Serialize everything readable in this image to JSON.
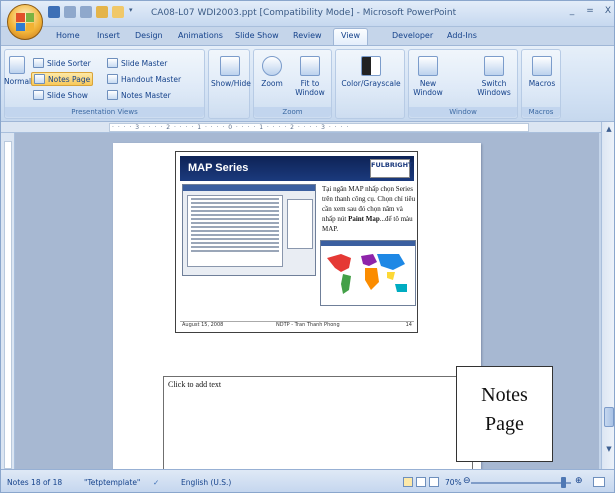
{
  "window": {
    "title": "CA08-L07 WDI2003.ppt [Compatibility Mode] - Microsoft PowerPoint",
    "controls": [
      "_",
      "=",
      "X"
    ]
  },
  "tabs": [
    {
      "label": "Home"
    },
    {
      "label": "Insert"
    },
    {
      "label": "Design"
    },
    {
      "label": "Animations"
    },
    {
      "label": "Slide Show"
    },
    {
      "label": "Review"
    },
    {
      "label": "View",
      "active": true
    },
    {
      "label": "Developer"
    },
    {
      "label": "Add-Ins"
    }
  ],
  "ribbon": {
    "presentation_views": {
      "normal": "Normal",
      "slide_sorter": "Slide Sorter",
      "notes_page": "Notes Page",
      "slide_show": "Slide Show",
      "slide_master": "Slide Master",
      "handout_master": "Handout Master",
      "notes_master": "Notes Master",
      "group_label": "Presentation Views"
    },
    "show_hide": "Show/Hide",
    "zoom": {
      "zoom": "Zoom",
      "fit_to_window": "Fit to Window",
      "group_label": "Zoom"
    },
    "color_grayscale": "Color/Grayscale",
    "window": {
      "new_window": "New Window",
      "switch_windows": "Switch Windows",
      "group_label": "Window"
    },
    "macros": {
      "macros": "Macros",
      "group_label": "Macros"
    }
  },
  "ruler": {
    "h_text": "· · · · 3 · · · · 2 · · · · 1 · · · · 0 · · · · 1 · · · · 2 · · · · 3 · · · ·"
  },
  "slide": {
    "title": "MAP Series",
    "logo": "FULBRIGHT",
    "note_line1": "Tại ngăn MAP nhấp chọn Series trên thanh công cụ. Chọn chỉ tiêu cần xem sau đó chọn năm và nhấp nút ",
    "note_bold": "Paint Map",
    "note_line2": "...để tô màu MAP.",
    "footer_left": "August 15, 2008",
    "footer_center": "NDTP - Tran Thanh Phong",
    "footer_right": "14"
  },
  "notes": {
    "placeholder": "Click to add text"
  },
  "callout": {
    "line1": "Notes",
    "line2": "Page"
  },
  "status": {
    "slide_count": "Notes 18 of 18",
    "theme": "\"Tetptemplate\"",
    "language": "English (U.S.)",
    "zoom": "70%"
  },
  "colors": {
    "accent": "#15428b",
    "active_button": "#f8c859",
    "slide_header": "#1b3a7d"
  }
}
